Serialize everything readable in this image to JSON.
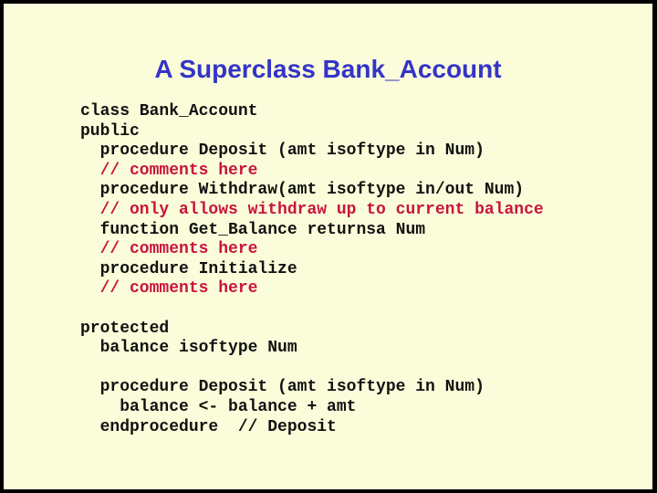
{
  "slide": {
    "title": "A Superclass Bank_Account",
    "code_lines": [
      {
        "text": "class Bank_Account",
        "type": "code"
      },
      {
        "text": "public",
        "type": "code"
      },
      {
        "text": "  procedure Deposit (amt isoftype in Num)",
        "type": "code"
      },
      {
        "text": "  // comments here",
        "type": "comment"
      },
      {
        "text": "  procedure Withdraw(amt isoftype in/out Num)",
        "type": "code"
      },
      {
        "text": "  // only allows withdraw up to current balance",
        "type": "comment"
      },
      {
        "text": "  function Get_Balance returnsa Num",
        "type": "code"
      },
      {
        "text": "  // comments here",
        "type": "comment"
      },
      {
        "text": "  procedure Initialize",
        "type": "code"
      },
      {
        "text": "  // comments here",
        "type": "comment"
      },
      {
        "text": "",
        "type": "blank"
      },
      {
        "text": "protected",
        "type": "code"
      },
      {
        "text": "  balance isoftype Num",
        "type": "code"
      },
      {
        "text": "",
        "type": "blank"
      },
      {
        "text": "  procedure Deposit (amt isoftype in Num)",
        "type": "code"
      },
      {
        "text": "    balance <- balance + amt",
        "type": "code"
      },
      {
        "text": "  endprocedure  // Deposit",
        "type": "code"
      }
    ]
  },
  "colors": {
    "background": "#FBFDDA",
    "border": "#000000",
    "title": "#3434C8",
    "code": "#111111",
    "comment": "#C8143C"
  }
}
